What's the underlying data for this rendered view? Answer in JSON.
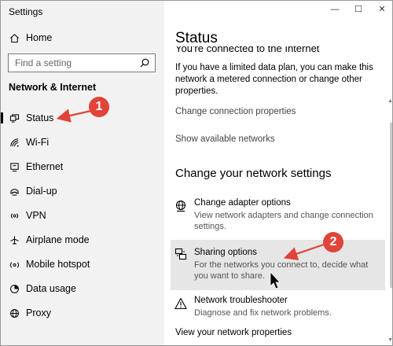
{
  "window": {
    "title": "Settings",
    "controls": {
      "minimize": "—",
      "maximize": "☐",
      "close": "✕"
    }
  },
  "sidebar": {
    "home": "Home",
    "search_placeholder": "Find a setting",
    "section_title": "Network & Internet",
    "items": [
      {
        "label": "Status",
        "icon": "status-icon"
      },
      {
        "label": "Wi-Fi",
        "icon": "wifi-icon"
      },
      {
        "label": "Ethernet",
        "icon": "ethernet-icon"
      },
      {
        "label": "Dial-up",
        "icon": "dial-up-icon"
      },
      {
        "label": "VPN",
        "icon": "vpn-icon"
      },
      {
        "label": "Airplane mode",
        "icon": "airplane-icon"
      },
      {
        "label": "Mobile hotspot",
        "icon": "hotspot-icon"
      },
      {
        "label": "Data usage",
        "icon": "data-usage-icon"
      },
      {
        "label": "Proxy",
        "icon": "proxy-icon"
      }
    ],
    "selected": "Status"
  },
  "main": {
    "title": "Status",
    "cut_heading": "You're connected to the Internet",
    "info": "If you have a limited data plan, you can make this network a metered connection or change other properties.",
    "links": {
      "change_connection": "Change connection properties",
      "show_networks": "Show available networks",
      "view_properties": "View your network properties"
    },
    "section_heading": "Change your network settings",
    "options": [
      {
        "title": "Change adapter options",
        "desc": "View network adapters and change connection settings.",
        "icon": "adapter-icon"
      },
      {
        "title": "Sharing options",
        "desc": "For the networks you connect to, decide what you want to share.",
        "icon": "sharing-icon"
      },
      {
        "title": "Network troubleshooter",
        "desc": "Diagnose and fix network problems.",
        "icon": "warning-icon"
      }
    ]
  },
  "annotations": {
    "badge_1": "1",
    "badge_2": "2",
    "color": "#e0443a"
  }
}
